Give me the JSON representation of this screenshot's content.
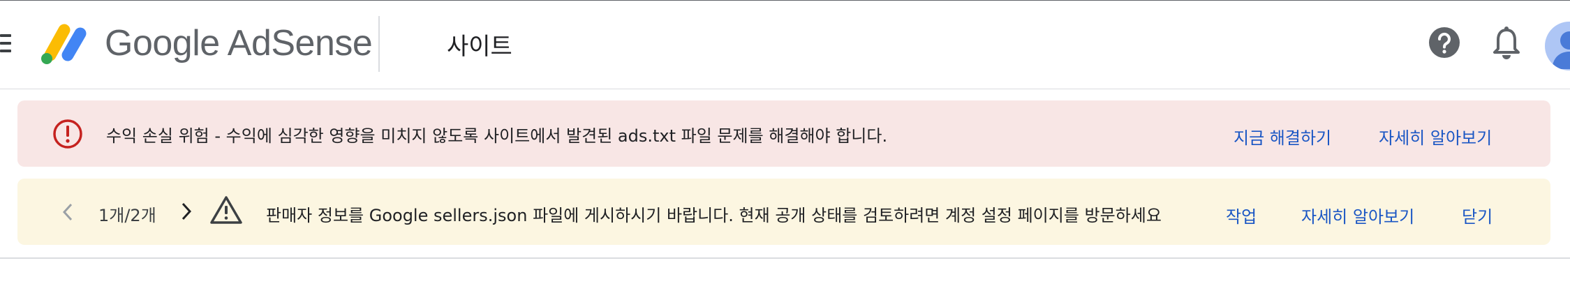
{
  "header": {
    "brand": "Google AdSense",
    "page_title": "사이트",
    "icons": {
      "menu": "hamburger-menu-icon",
      "help": "help-icon",
      "notifications": "bell-icon",
      "avatar": "avatar"
    }
  },
  "alerts": {
    "error": {
      "icon": "error-icon",
      "message": "수익 손실 위험 - 수익에 심각한 영향을 미치지 않도록 사이트에서 발견된 ads.txt 파일 문제를 해결해야 합니다.",
      "action_fix": "지금 해결하기",
      "action_learn": "자세히 알아보기"
    },
    "warning": {
      "icon": "warning-icon",
      "pager": "1개/2개",
      "message": "판매자 정보를 Google sellers.json 파일에 게시하시기 바랍니다. 현재 공개 상태를 검토하려면 계정 설정 페이지를 방문하세요",
      "action_task": "작업",
      "action_learn": "자세히 알아보기",
      "action_close": "닫기"
    }
  },
  "colors": {
    "error_bg": "#f8e6e5",
    "warning_bg": "#fcf6e1",
    "link": "#1a56c4",
    "error_icon": "#c5221f"
  }
}
